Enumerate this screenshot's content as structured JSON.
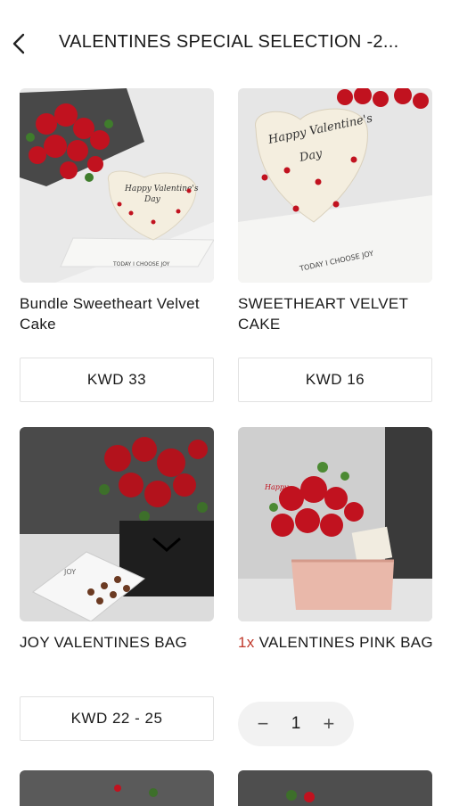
{
  "header": {
    "title": "VALENTINES SPECIAL SELECTION -2..."
  },
  "products": [
    {
      "name": "Bundle Sweetheart Velvet Cake",
      "price": "KWD 33",
      "image_icon": "heart-cake-bouquet"
    },
    {
      "name": "SWEETHEART VELVET CAKE",
      "price": "KWD 16",
      "image_icon": "heart-cake"
    },
    {
      "name": "JOY VALENTINES BAG",
      "price": "KWD 22 - 25",
      "image_icon": "rose-bag-chocolates"
    },
    {
      "name": "VALENTINES PINK BAG",
      "qty_prefix": "1x",
      "qty": "1",
      "minus": "−",
      "plus": "+",
      "image_icon": "pink-rose-bag"
    }
  ],
  "colors": {
    "qty_prefix": "#c0392b",
    "stepper_bg": "#f2f2f2"
  }
}
